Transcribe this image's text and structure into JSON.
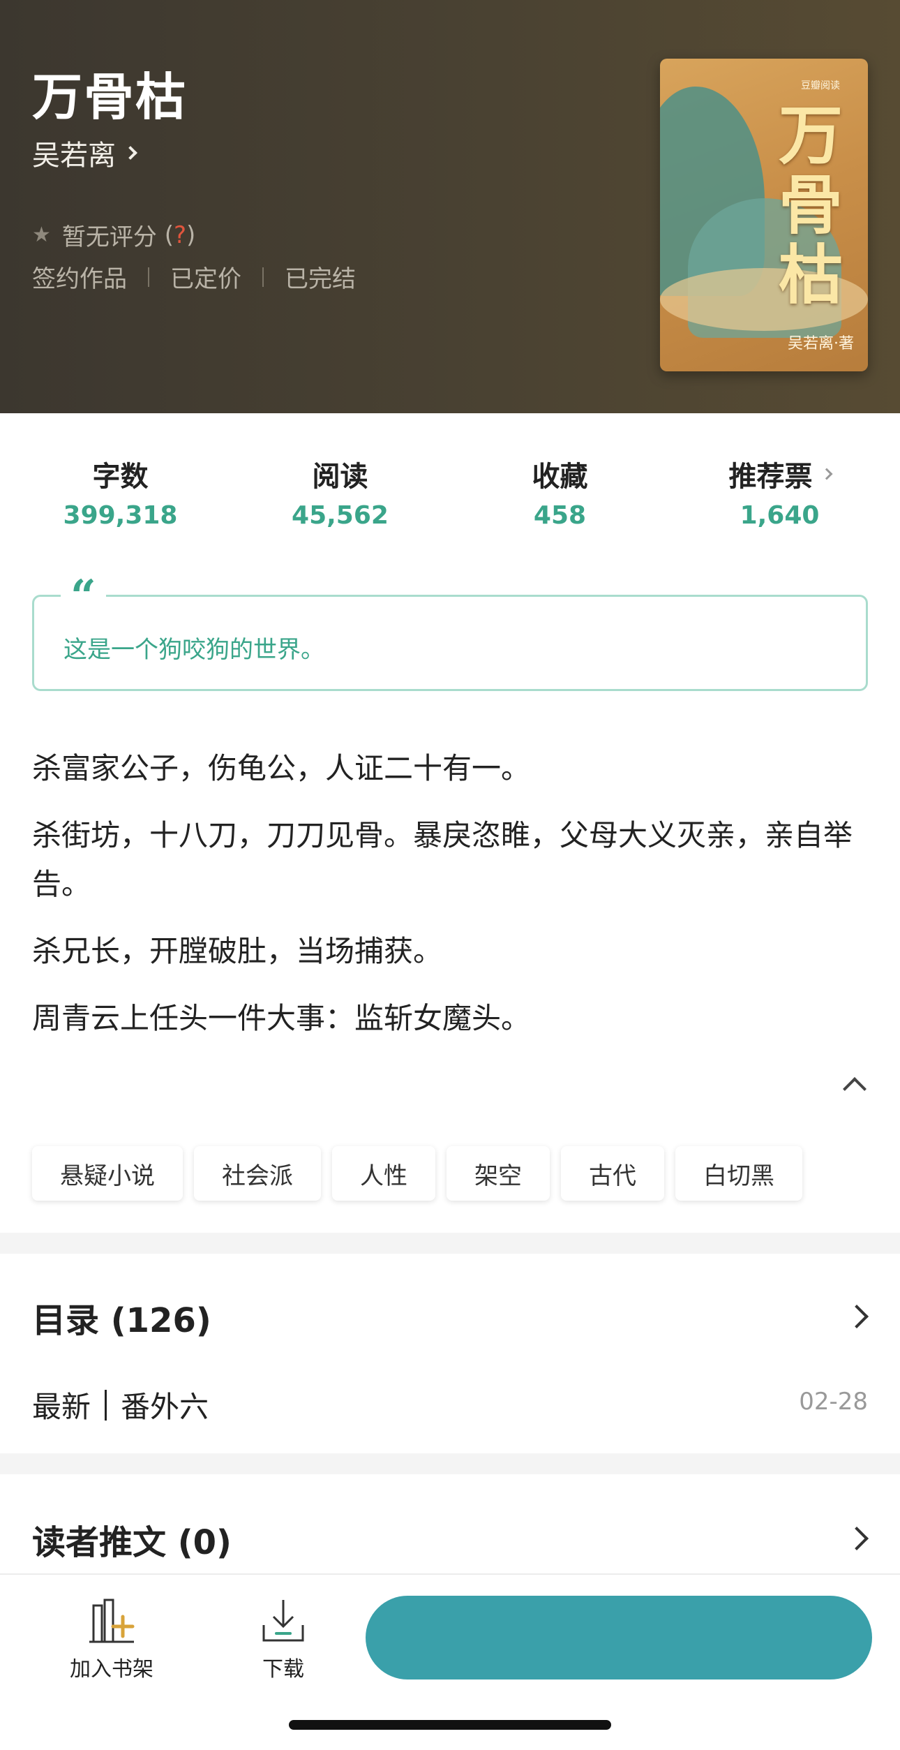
{
  "header": {
    "title": "万骨枯",
    "author": "吴若离",
    "rating": {
      "text": "暂无评分",
      "help_open": "(",
      "help_mark": "?",
      "help_close": ")"
    },
    "meta": [
      "签约作品",
      "已定价",
      "已完结"
    ],
    "cover": {
      "brand": "豆瓣阅读",
      "title": "万骨枯",
      "author": "吴若离·著"
    }
  },
  "stats": [
    {
      "label": "字数",
      "value": "399,318"
    },
    {
      "label": "阅读",
      "value": "45,562"
    },
    {
      "label": "收藏",
      "value": "458"
    },
    {
      "label": "推荐票",
      "value": "1,640"
    }
  ],
  "quote": "这是一个狗咬狗的世界。",
  "intro": [
    "杀富家公子，伤龟公，人证二十有一。",
    "杀街坊，十八刀，刀刀见骨。暴戾恣睢，父母大义灭亲，亲自举告。",
    "杀兄长，开膛破肚，当场捕获。",
    "周青云上任头一件大事：监斩女魔头。"
  ],
  "tags": [
    "悬疑小说",
    "社会派",
    "人性",
    "架空",
    "古代",
    "白切黑"
  ],
  "catalog": {
    "title": "目录 (126)",
    "latest_label": "最新",
    "latest_chapter": "番外六",
    "latest_date": "02-28"
  },
  "posts": {
    "title": "读者推文 (0)"
  },
  "bottombar": {
    "shelf": "加入书架",
    "download": "下载",
    "cta": ""
  },
  "colors": {
    "accent": "#3aa58a",
    "cta": "#3aa0aa",
    "header_bg": "#4a4232"
  }
}
